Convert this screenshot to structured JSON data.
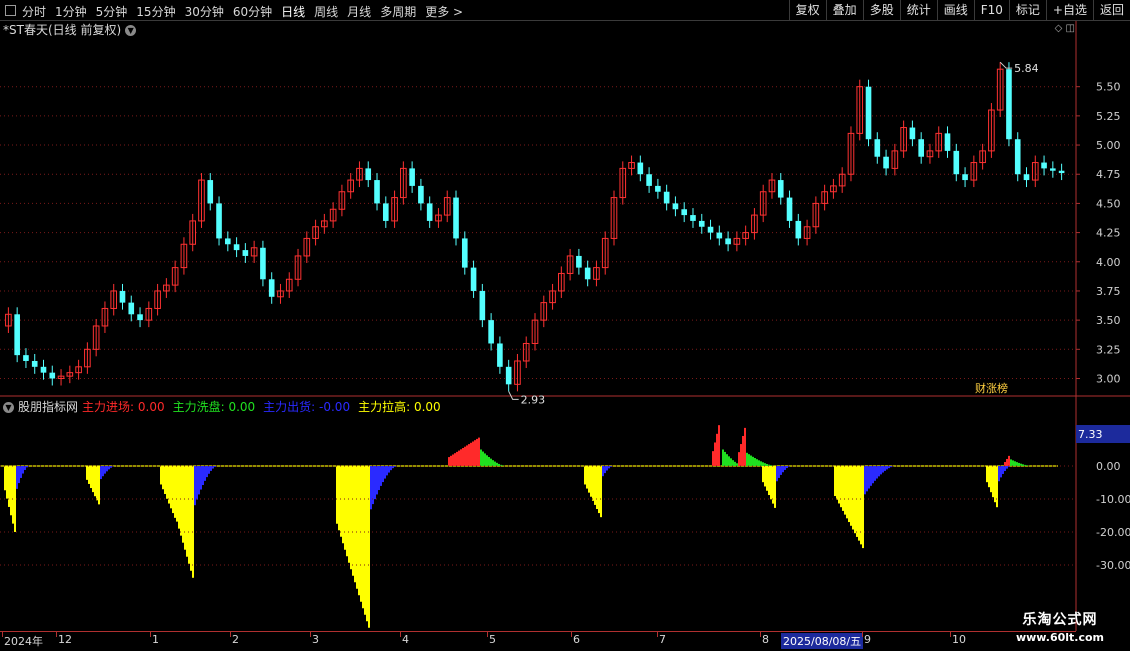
{
  "toolbar": {
    "periods": [
      "分时",
      "1分钟",
      "5分钟",
      "15分钟",
      "30分钟",
      "60分钟",
      "日线",
      "周线",
      "月线",
      "多周期",
      "更多 >"
    ],
    "active_period": "日线",
    "right_buttons": [
      "复权",
      "叠加",
      "多股",
      "统计",
      "画线",
      "F10",
      "标记",
      "+自选",
      "返回"
    ]
  },
  "main_chart": {
    "title": "*ST春天(日线 前复权)",
    "y_ticks": [
      "5.50",
      "5.25",
      "5.00",
      "4.75",
      "4.50",
      "4.25",
      "4.00",
      "3.75",
      "3.50",
      "3.25",
      "3.00"
    ],
    "high_label": "5.84",
    "low_label": "2.93",
    "badge": "涨榜",
    "badge_prefix": "财"
  },
  "indicator": {
    "name": "股朋指标网",
    "legend": [
      {
        "label": "主力进场:",
        "value": "0.00",
        "color": "#ff2a2a"
      },
      {
        "label": "主力洗盘:",
        "value": "0.00",
        "color": "#20e020"
      },
      {
        "label": "主力出货:",
        "value": "-0.00",
        "color": "#2a2aff"
      },
      {
        "label": "主力拉高:",
        "value": "0.00",
        "color": "#ffff00"
      }
    ],
    "y_ticks": [
      "0.00",
      "-10.00",
      "-20.00",
      "-30.00"
    ],
    "current_value": "7.33"
  },
  "date_axis": {
    "labels": [
      "2024年",
      "12",
      "1",
      "2",
      "3",
      "4",
      "5",
      "6",
      "7",
      "8",
      "9",
      "10"
    ],
    "selected_date": "2025/08/08/五"
  },
  "watermark": {
    "line1": "乐淘公式网",
    "line2": "www.60lt.com"
  },
  "chart_data": {
    "type": "candlestick",
    "series_name": "*ST春天",
    "y_range": [
      2.85,
      5.9
    ],
    "close": [
      3.55,
      3.2,
      3.15,
      3.1,
      3.05,
      3.0,
      3.02,
      3.05,
      3.1,
      3.25,
      3.45,
      3.6,
      3.75,
      3.65,
      3.55,
      3.5,
      3.6,
      3.75,
      3.8,
      3.95,
      4.15,
      4.35,
      4.7,
      4.5,
      4.2,
      4.15,
      4.1,
      4.05,
      4.12,
      3.85,
      3.7,
      3.75,
      3.85,
      4.05,
      4.2,
      4.3,
      4.35,
      4.45,
      4.6,
      4.7,
      4.8,
      4.7,
      4.5,
      4.35,
      4.55,
      4.8,
      4.65,
      4.5,
      4.35,
      4.4,
      4.55,
      4.2,
      3.95,
      3.75,
      3.5,
      3.3,
      3.1,
      2.95,
      3.15,
      3.3,
      3.5,
      3.65,
      3.75,
      3.9,
      4.05,
      3.95,
      3.85,
      3.95,
      4.2,
      4.55,
      4.8,
      4.85,
      4.75,
      4.65,
      4.6,
      4.5,
      4.45,
      4.4,
      4.35,
      4.3,
      4.25,
      4.2,
      4.15,
      4.2,
      4.25,
      4.4,
      4.6,
      4.7,
      4.55,
      4.35,
      4.2,
      4.3,
      4.5,
      4.6,
      4.65,
      4.75,
      5.1,
      5.5,
      5.05,
      4.9,
      4.8,
      4.95,
      5.15,
      5.05,
      4.9,
      4.95,
      5.1,
      4.95,
      4.75,
      4.7,
      4.85,
      4.95,
      5.3,
      5.65,
      5.05,
      4.75,
      4.7,
      4.85,
      4.8,
      4.78,
      4.76
    ]
  }
}
